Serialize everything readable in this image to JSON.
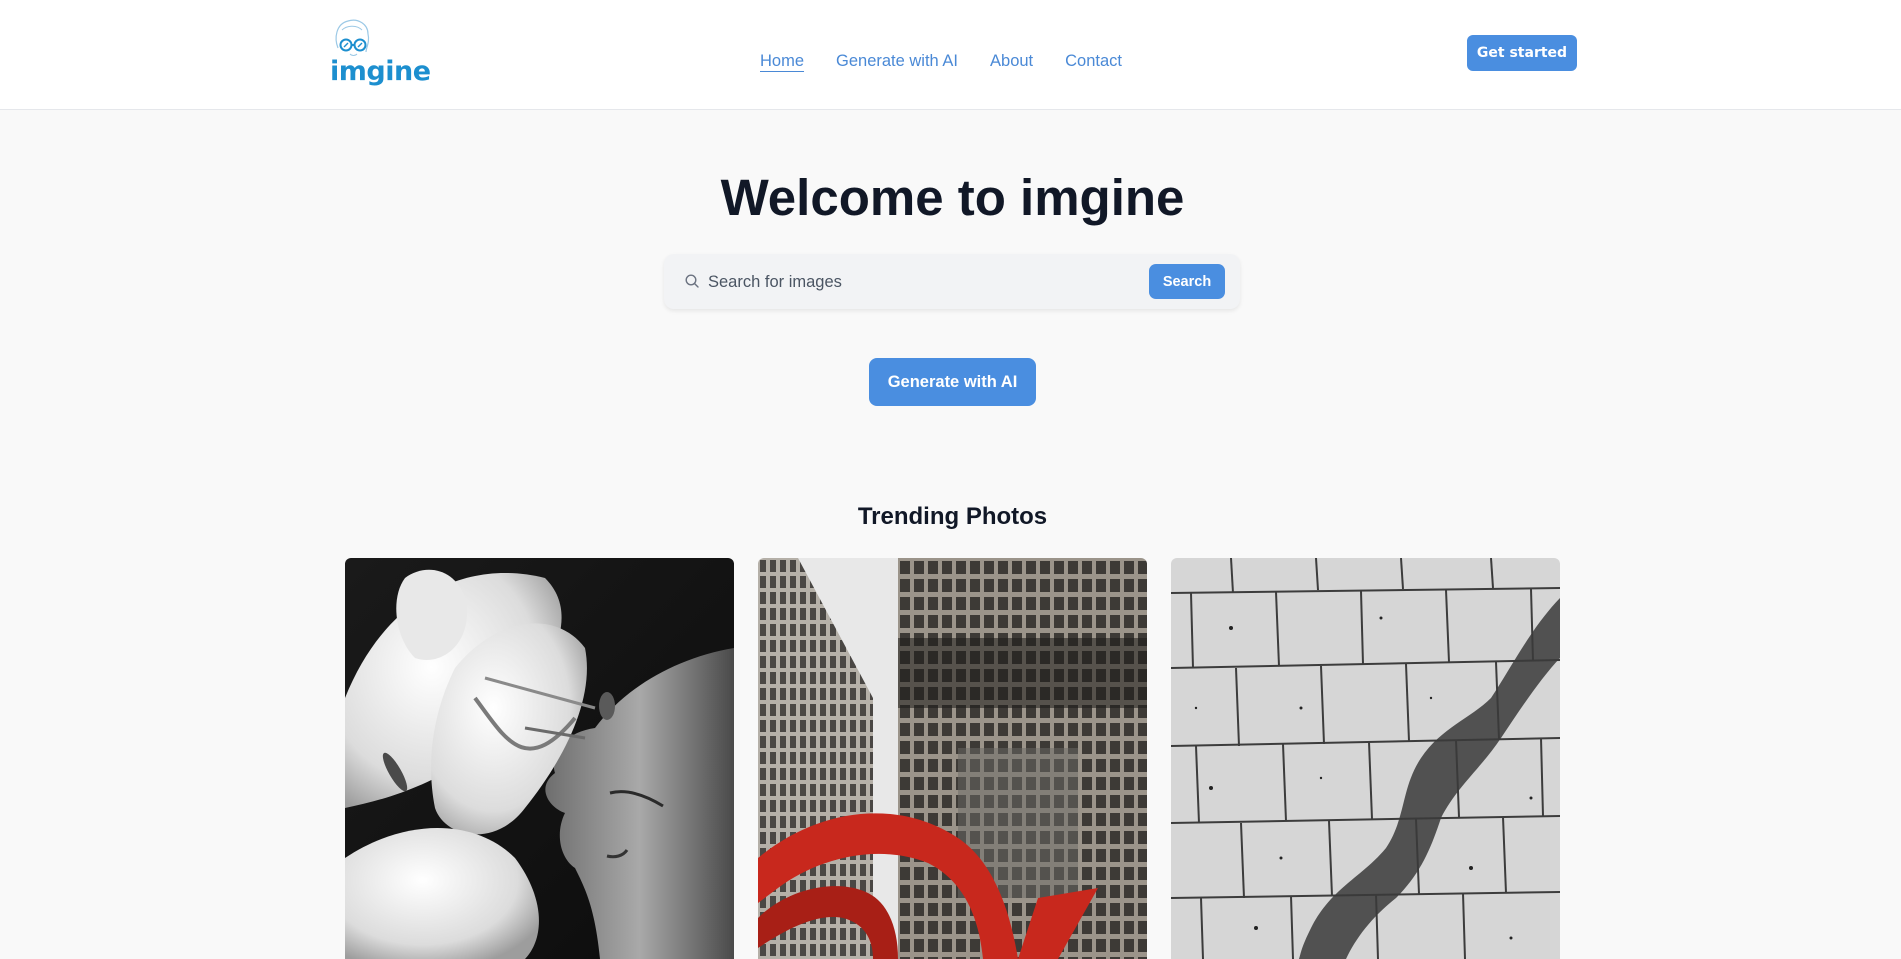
{
  "brand": {
    "name": "imgine",
    "color": "#1d8fcf"
  },
  "nav": {
    "items": [
      {
        "label": "Home",
        "active": true
      },
      {
        "label": "Generate with AI",
        "active": false
      },
      {
        "label": "About",
        "active": false
      },
      {
        "label": "Contact",
        "active": false
      }
    ],
    "cta_label": "Get started"
  },
  "hero": {
    "title": "Welcome to imgine",
    "search": {
      "placeholder": "Search for images",
      "value": "",
      "button_label": "Search",
      "icon": "search-icon"
    },
    "generate_label": "Generate with AI"
  },
  "trending": {
    "title": "Trending Photos",
    "photos": [
      {
        "subject": "woman-with-lily-bw"
      },
      {
        "subject": "skyscrapers-red-sculpture"
      },
      {
        "subject": "shadow-on-tiles"
      }
    ]
  },
  "colors": {
    "accent": "#4a8ee0",
    "link": "#4a89d6",
    "background": "#f9f9f9",
    "heading": "#111827"
  }
}
